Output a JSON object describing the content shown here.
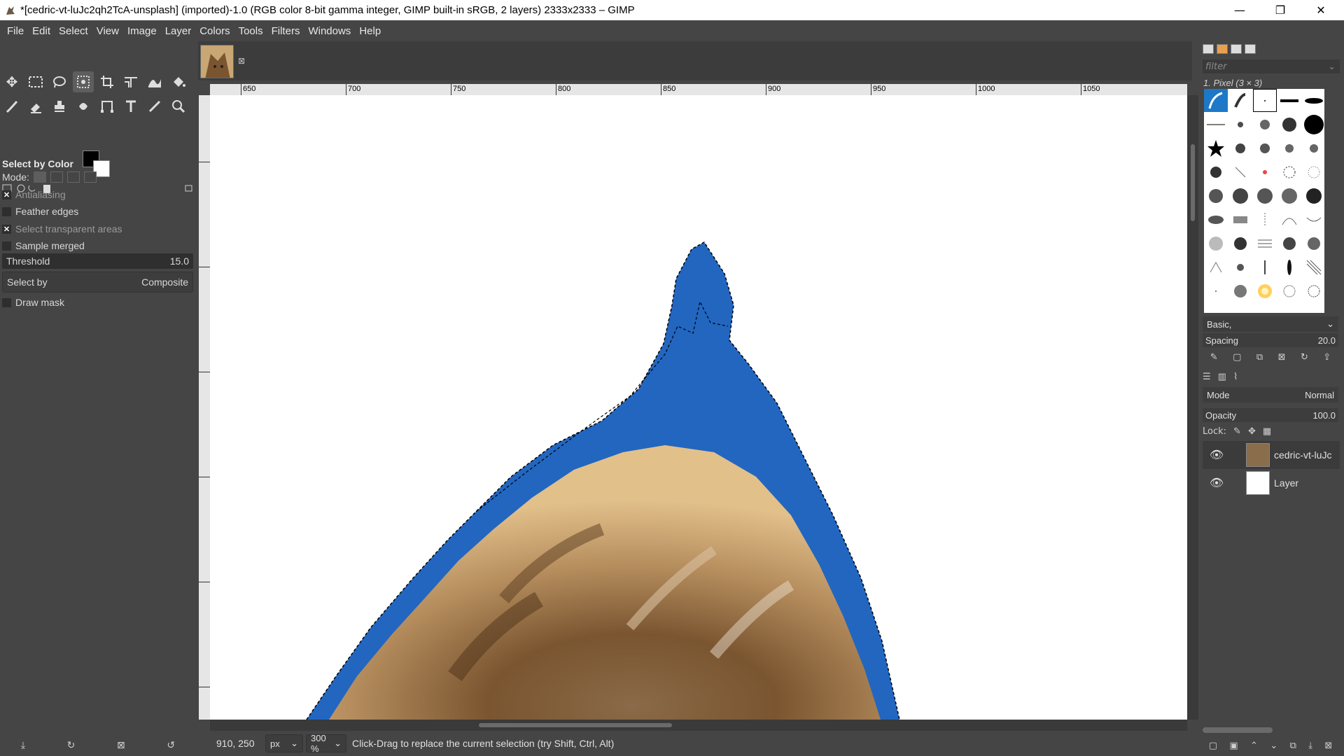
{
  "window": {
    "title": "*[cedric-vt-luJc2qh2TcA-unsplash] (imported)-1.0 (RGB color 8-bit gamma integer, GIMP built-in sRGB, 2 layers) 2333x2333 – GIMP",
    "controls": {
      "minimize": "—",
      "maximize": "❐",
      "close": "✕"
    }
  },
  "menu": [
    "File",
    "Edit",
    "Select",
    "View",
    "Image",
    "Layer",
    "Colors",
    "Tools",
    "Filters",
    "Windows",
    "Help"
  ],
  "toolbox": {
    "tools_row1": [
      "move-icon",
      "rect-select-icon",
      "lasso-icon",
      "fuzzy-select-icon",
      "crop-icon",
      "transform-icon",
      "warp-icon",
      "bucket-fill-icon"
    ],
    "tools_row2": [
      "paintbrush-icon",
      "eraser-icon",
      "clone-icon",
      "smudge-icon",
      "paths-icon",
      "text-icon",
      "color-picker-icon",
      "zoom-icon"
    ],
    "active_tool": "fuzzy-select-icon",
    "fg_color": "#000000",
    "bg_color": "#ffffff"
  },
  "tool_options": {
    "header": "Select by Color",
    "mode_label": "Mode:",
    "antialiasing": {
      "label": "Antialiasing",
      "checked": true
    },
    "feather_edges": {
      "label": "Feather edges",
      "checked": false
    },
    "select_transparent": {
      "label": "Select transparent areas",
      "checked": true
    },
    "sample_merged": {
      "label": "Sample merged",
      "checked": false
    },
    "threshold": {
      "label": "Threshold",
      "value": "15.0"
    },
    "select_by": {
      "label": "Select by",
      "value": "Composite"
    },
    "draw_mask": {
      "label": "Draw mask",
      "checked": false
    },
    "check_mark": "✕"
  },
  "ruler": {
    "labels": [
      "650",
      "700",
      "750",
      "800",
      "850",
      "900",
      "950",
      "1000",
      "1050"
    ]
  },
  "statusbar": {
    "pointer": "910, 250",
    "unit": "px",
    "zoom": "300 %",
    "message": "Click-Drag to replace the current selection (try Shift, Ctrl, Alt)"
  },
  "brushes": {
    "filter_placeholder": "filter",
    "current": "1. Pixel (3 × 3)",
    "preset": "Basic,",
    "spacing": {
      "label": "Spacing",
      "value": "20.0"
    }
  },
  "layers": {
    "mode": {
      "label": "Mode",
      "value": "Normal"
    },
    "opacity": {
      "label": "Opacity",
      "value": "100.0"
    },
    "lock_label": "Lock:",
    "items": [
      {
        "name": "cedric-vt-luJc",
        "visible": true,
        "selected": true
      },
      {
        "name": "Layer",
        "visible": true,
        "selected": false
      }
    ]
  },
  "colors": {
    "selection_blue": "#2266c0",
    "fur_light": "#e2c08a",
    "fur_dark": "#7a5530",
    "ui_bg": "#454545"
  }
}
